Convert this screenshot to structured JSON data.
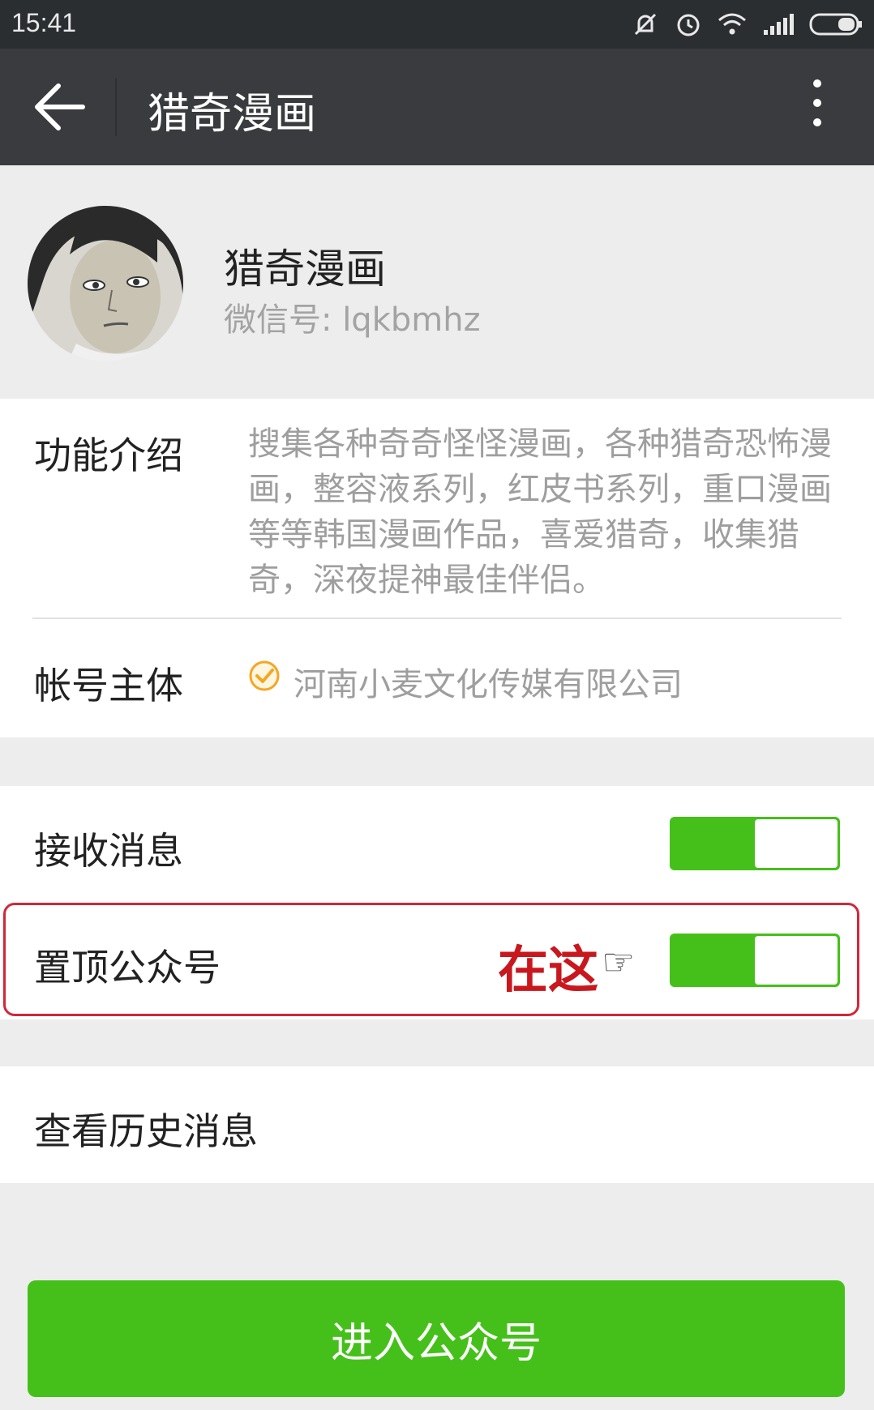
{
  "status_bar": {
    "time": "15:41"
  },
  "app_bar": {
    "title": "猎奇漫画"
  },
  "profile": {
    "name": "猎奇漫画",
    "wechat_id": "微信号: lqkbmhz"
  },
  "info": {
    "intro_label": "功能介绍",
    "intro_text": "搜集各种奇奇怪怪漫画，各种猎奇恐怖漫画，整容液系列，红皮书系列，重口漫画等等韩国漫画作品，喜爱猎奇，收集猎奇，深夜提神最佳伴侣。",
    "owner_label": "帐号主体",
    "owner_value": "河南小麦文化传媒有限公司"
  },
  "settings": {
    "receive_label": "接收消息",
    "receive_on": true,
    "pin_label": "置顶公众号",
    "pin_on": true,
    "annotation": "在这"
  },
  "history": {
    "label": "查看历史消息"
  },
  "enter_button": {
    "label": "进入公众号"
  },
  "colors": {
    "accent_green": "#45c01a",
    "annotation_red": "#c8181e",
    "app_bar": "#393b3e"
  }
}
